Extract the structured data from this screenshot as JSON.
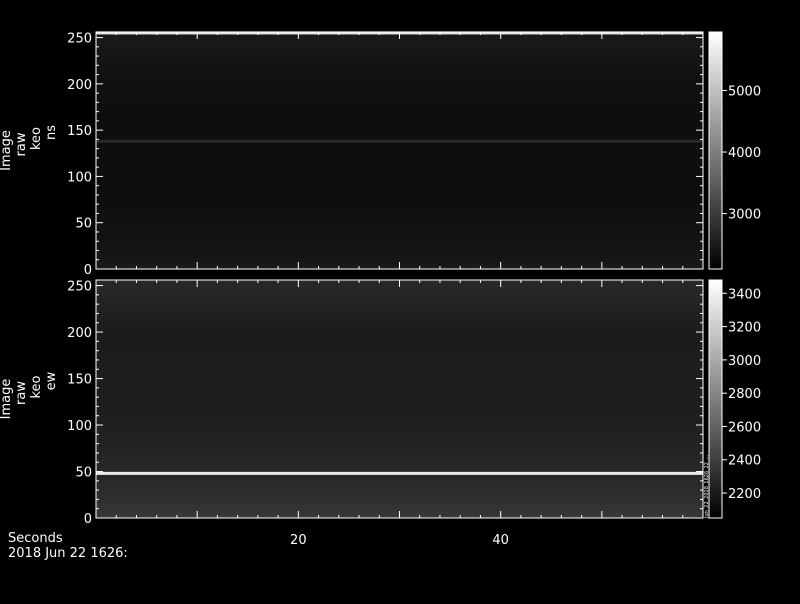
{
  "footer": {
    "x_title": "Seconds",
    "date_label": "2018 Jun 22 1626:"
  },
  "chart_data": [
    {
      "type": "heatmap",
      "ylabel": [
        "Image",
        "raw",
        "keo",
        "ns"
      ],
      "xlim": [
        0,
        60
      ],
      "ylim": [
        0,
        256
      ],
      "yticks": [
        0,
        50,
        100,
        150,
        200,
        250
      ],
      "xticks": [
        20,
        40
      ],
      "x_tick_labels_shown": false,
      "colorbar": {
        "range": [
          2100,
          5950
        ],
        "ticks": [
          3000,
          4000,
          5000
        ]
      },
      "notable_rows": [
        {
          "y": 138,
          "intensity": 0.16
        },
        {
          "y": 255,
          "intensity": 0.9
        }
      ],
      "background_profile": [
        {
          "y": 0,
          "intensity": 0.1
        },
        {
          "y": 20,
          "intensity": 0.08
        },
        {
          "y": 80,
          "intensity": 0.05
        },
        {
          "y": 200,
          "intensity": 0.06
        },
        {
          "y": 240,
          "intensity": 0.09
        },
        {
          "y": 256,
          "intensity": 0.1
        }
      ]
    },
    {
      "type": "heatmap",
      "ylabel": [
        "Image",
        "raw",
        "keo",
        "ew"
      ],
      "xlim": [
        0,
        60
      ],
      "ylim": [
        0,
        256
      ],
      "yticks": [
        0,
        50,
        100,
        150,
        200,
        250
      ],
      "xticks": [
        20,
        40
      ],
      "x_tick_labels_shown": true,
      "colorbar": {
        "range": [
          2050,
          3480
        ],
        "ticks": [
          2200,
          2400,
          2600,
          2800,
          3000,
          3200,
          3400
        ]
      },
      "side_annotation": "Jun_22_2018_1626_22_...",
      "notable_rows": [
        {
          "y": 48,
          "intensity": 0.92
        }
      ],
      "background_profile": [
        {
          "y": 0,
          "intensity": 0.22
        },
        {
          "y": 30,
          "intensity": 0.17
        },
        {
          "y": 100,
          "intensity": 0.12
        },
        {
          "y": 200,
          "intensity": 0.11
        },
        {
          "y": 256,
          "intensity": 0.16
        }
      ]
    }
  ]
}
